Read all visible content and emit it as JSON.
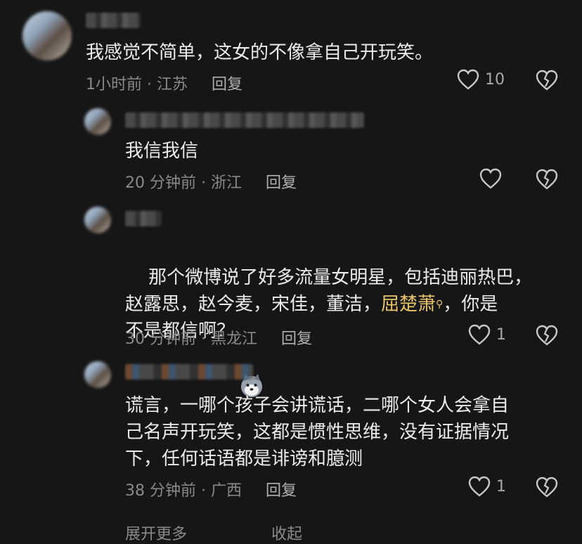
{
  "comments": [
    {
      "text": "我感觉不简单，这女的不像拿自己开玩笑。",
      "meta": "1小时前 · 江苏",
      "reply": "回复",
      "likes": "10"
    },
    {
      "text": "我信我信",
      "meta": "20 分钟前 · 浙江",
      "reply": "回复",
      "likes": ""
    },
    {
      "text_a": "那个微博说了好多流量女明星，包括迪丽热巴，\n赵露思，赵今麦，宋佳，董洁，",
      "highlight": "屈楚萧",
      "text_b": "，你是\n不是都信啊？",
      "meta": "30 分钟前 · 黑龙江",
      "reply": "回复",
      "likes": "1"
    },
    {
      "text": "谎言，一哪个孩子会讲谎话，二哪个女人会拿自\n己名声开玩笑，这都是惯性思维，没有证据情况\n下，任何话语都是诽谤和臆测",
      "meta": "38 分钟前 · 广西",
      "reply": "回复",
      "likes": "1"
    }
  ],
  "footer": {
    "expand": "展开更多",
    "collapse": "收起"
  },
  "colors": {
    "background": "#161616",
    "highlight": "#e9c46a"
  }
}
